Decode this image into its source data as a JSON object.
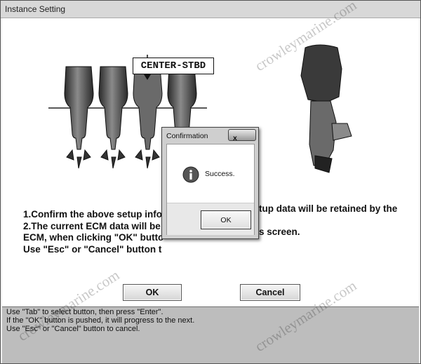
{
  "window": {
    "title": "Instance Setting"
  },
  "setup": {
    "position_label": "CENTER-STBD"
  },
  "instructions": [
    "1.Confirm the above setup infor",
    "2.The current ECM data will be c",
    "ECM, when clicking \"OK\" butto",
    "Use \"Esc\" or \"Cancel\" button t",
    "tup data will be retained by the",
    "s screen."
  ],
  "buttons": {
    "ok": "OK",
    "cancel": "Cancel"
  },
  "status": [
    "Use \"Tab\" to select button, then press \"Enter\".",
    "If the \"OK\" button is pushed, it will progress to the next.",
    "Use \"Esc\" or \"Cancel\" button to cancel."
  ],
  "dialog": {
    "title": "Confirmation",
    "close": "x",
    "message": "Success.",
    "ok": "OK",
    "icon": "info-icon"
  },
  "watermark": "crowleymarine.com"
}
